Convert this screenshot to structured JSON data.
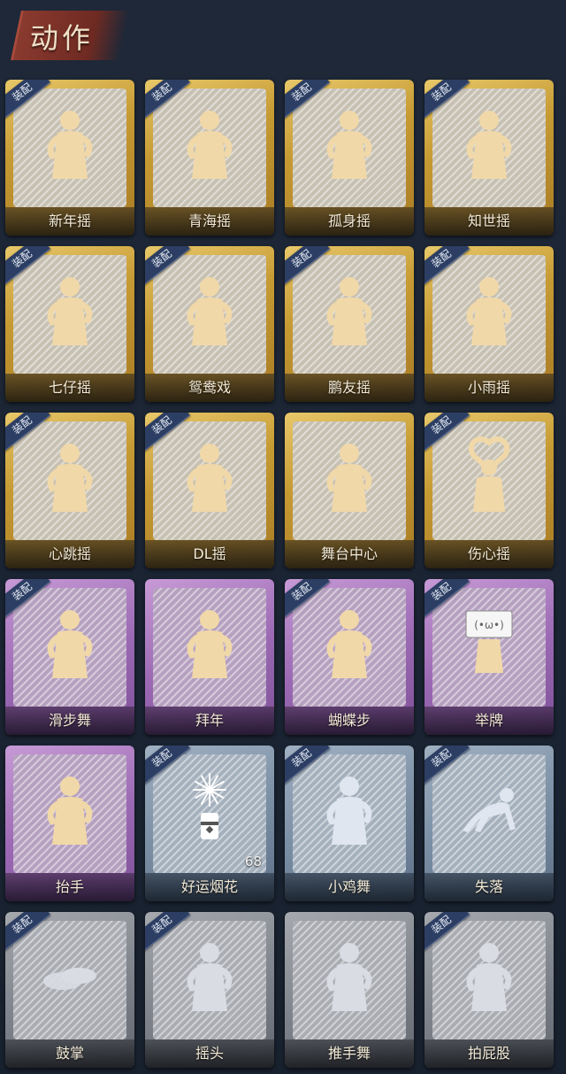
{
  "header": {
    "title": "动作"
  },
  "badge_text": "装配",
  "tier_colors": {
    "gold": "#c69a33",
    "purple": "#9c6ab4",
    "blue": "#7a8ea4",
    "grey": "#80858d"
  },
  "items": [
    {
      "label": "新年摇",
      "tier": "gold",
      "equipped": true,
      "count": null,
      "icon": "dance-figure-icon"
    },
    {
      "label": "青海摇",
      "tier": "gold",
      "equipped": true,
      "count": null,
      "icon": "dance-figure-icon"
    },
    {
      "label": "孤身摇",
      "tier": "gold",
      "equipped": true,
      "count": null,
      "icon": "dance-figure-icon"
    },
    {
      "label": "知世摇",
      "tier": "gold",
      "equipped": true,
      "count": null,
      "icon": "dance-figure-icon"
    },
    {
      "label": "七仔摇",
      "tier": "gold",
      "equipped": true,
      "count": null,
      "icon": "dance-figure-icon"
    },
    {
      "label": "鸳鸯戏",
      "tier": "gold",
      "equipped": true,
      "count": null,
      "icon": "dance-figure-icon"
    },
    {
      "label": "鹏友摇",
      "tier": "gold",
      "equipped": true,
      "count": null,
      "icon": "dance-figure-icon"
    },
    {
      "label": "小雨摇",
      "tier": "gold",
      "equipped": true,
      "count": null,
      "icon": "dance-figure-icon"
    },
    {
      "label": "心跳摇",
      "tier": "gold",
      "equipped": true,
      "count": null,
      "icon": "dance-figure-icon"
    },
    {
      "label": "DL摇",
      "tier": "gold",
      "equipped": true,
      "count": null,
      "icon": "dance-figure-icon"
    },
    {
      "label": "舞台中心",
      "tier": "gold",
      "equipped": false,
      "count": null,
      "icon": "dance-figure-icon"
    },
    {
      "label": "伤心摇",
      "tier": "gold",
      "equipped": true,
      "count": null,
      "icon": "heart-hands-figure-icon"
    },
    {
      "label": "滑步舞",
      "tier": "purple",
      "equipped": true,
      "count": null,
      "icon": "dance-figure-icon"
    },
    {
      "label": "拜年",
      "tier": "purple",
      "equipped": false,
      "count": null,
      "icon": "bow-figure-icon"
    },
    {
      "label": "蝴蝶步",
      "tier": "purple",
      "equipped": true,
      "count": null,
      "icon": "dance-figure-icon"
    },
    {
      "label": "举牌",
      "tier": "purple",
      "equipped": true,
      "count": null,
      "icon": "sign-figure-icon"
    },
    {
      "label": "抬手",
      "tier": "purple",
      "equipped": false,
      "count": null,
      "icon": "raise-hand-figure-icon"
    },
    {
      "label": "好运烟花",
      "tier": "blue",
      "equipped": true,
      "count": "68",
      "icon": "firework-icon"
    },
    {
      "label": "小鸡舞",
      "tier": "blue",
      "equipped": true,
      "count": null,
      "icon": "chicken-dance-figure-icon"
    },
    {
      "label": "失落",
      "tier": "blue",
      "equipped": true,
      "count": null,
      "icon": "crawl-figure-icon"
    },
    {
      "label": "鼓掌",
      "tier": "grey",
      "equipped": true,
      "count": null,
      "icon": "clap-hands-icon"
    },
    {
      "label": "摇头",
      "tier": "grey",
      "equipped": true,
      "count": null,
      "icon": "shake-head-figure-icon"
    },
    {
      "label": "推手舞",
      "tier": "grey",
      "equipped": false,
      "count": null,
      "icon": "push-hands-figure-icon"
    },
    {
      "label": "拍屁股",
      "tier": "grey",
      "equipped": true,
      "count": null,
      "icon": "pat-figure-icon"
    }
  ]
}
